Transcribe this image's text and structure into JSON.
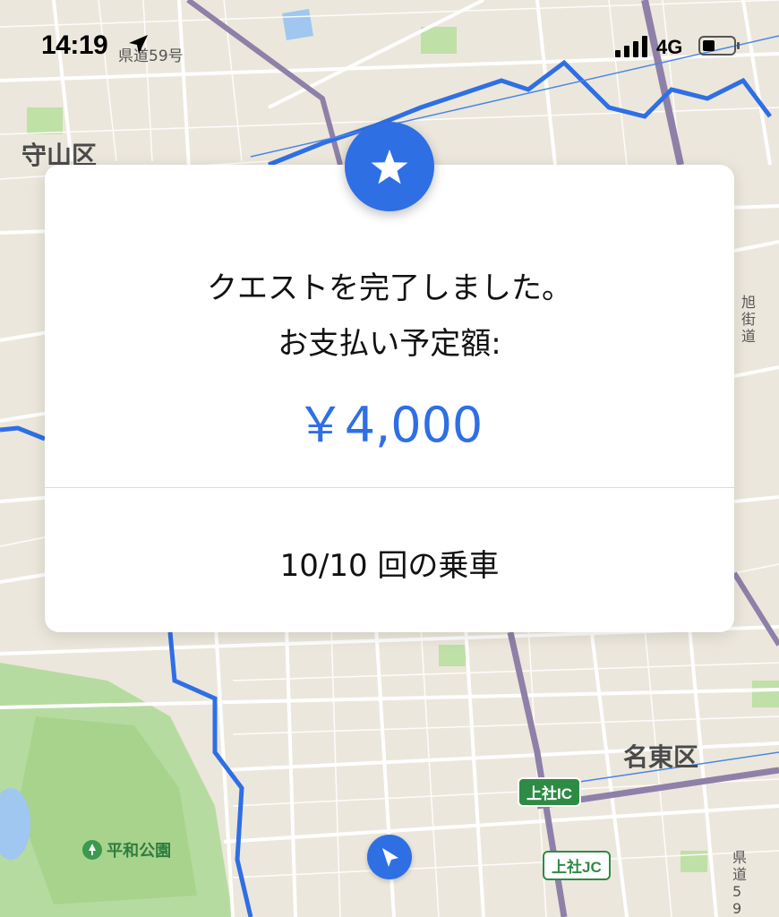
{
  "status_bar": {
    "time": "14:19",
    "network": "4G",
    "icons": [
      "location-arrow-icon",
      "signal-bars-icon",
      "battery-icon"
    ]
  },
  "map": {
    "labels": {
      "district_moriyama": "守山区",
      "district_meito": "名東区",
      "road_prefectural_59": "県道59号",
      "park": "平和公園",
      "road_asahi_kaido": "旭\n街\n道",
      "road_prefectural_59_right": "県\n道\n5\n9"
    },
    "badges": {
      "kamiyashiro_ic": "上社IC",
      "kamiyashiro_jc": "上社JC"
    },
    "colors": {
      "route": "#2f6fe4",
      "park_green": "#a8d38c",
      "road": "#ffffff",
      "expressway": "#8e80a8"
    }
  },
  "dialog": {
    "line1": "クエストを完了しました。",
    "line2": "お支払い予定額:",
    "amount": "￥4,000",
    "rides": "10/10 回の乗車",
    "icon": "star-icon",
    "accent": "#2f6fe4"
  }
}
